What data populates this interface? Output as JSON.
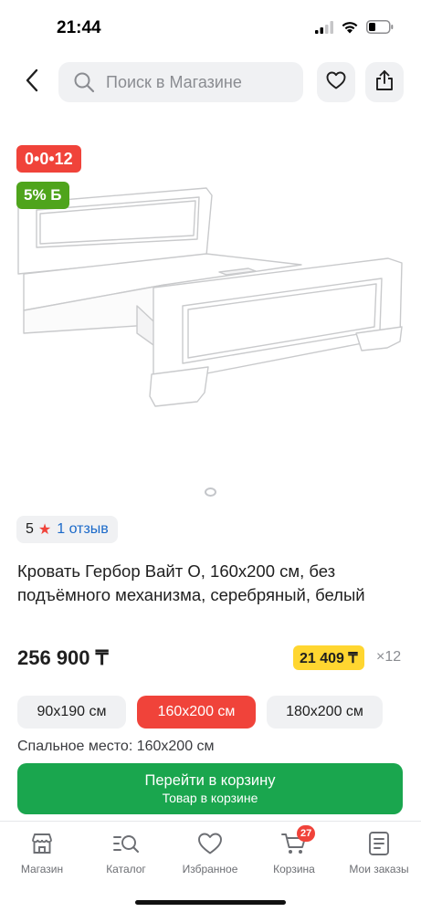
{
  "status_bar": {
    "time": "21:44"
  },
  "header": {
    "back_icon": "chevron-left-icon",
    "search_placeholder": "Поиск в Магазине",
    "favorite_icon": "heart-icon",
    "share_icon": "share-icon"
  },
  "badges": {
    "installment": "0•0•12",
    "bonus": "5% Б"
  },
  "gallery": {
    "current_index": 1,
    "total": 1
  },
  "rating": {
    "value": "5",
    "reviews": "1 отзыв"
  },
  "product": {
    "title": "Кровать Гербор Вайт О, 160х200 см, без подъёмного механизма, серебряный, белый",
    "price": "256 900 ₸",
    "monthly_price": "21 409 ₸",
    "monthly_term": "×12"
  },
  "sizes": {
    "options": [
      "90х190 см",
      "160х200 см",
      "180х200 см"
    ],
    "selected": "160х200 см"
  },
  "sleeping_place": "Спальное место: 160х200 см",
  "cart_button": {
    "label": "Перейти в корзину",
    "sublabel": "Товар в корзине"
  },
  "tab_bar": {
    "items": [
      {
        "label": "Магазин",
        "icon": "shop-icon"
      },
      {
        "label": "Каталог",
        "icon": "catalog-search-icon"
      },
      {
        "label": "Избранное",
        "icon": "heart-icon"
      },
      {
        "label": "Корзина",
        "icon": "cart-icon"
      },
      {
        "label": "Мои заказы",
        "icon": "orders-icon"
      }
    ],
    "cart_count": "27"
  },
  "colors": {
    "accent_red": "#f0433a",
    "accent_green": "#1aa64e",
    "bonus_green": "#4fa41c",
    "installment_yellow": "#ffd630",
    "link_blue": "#1a69c9"
  }
}
